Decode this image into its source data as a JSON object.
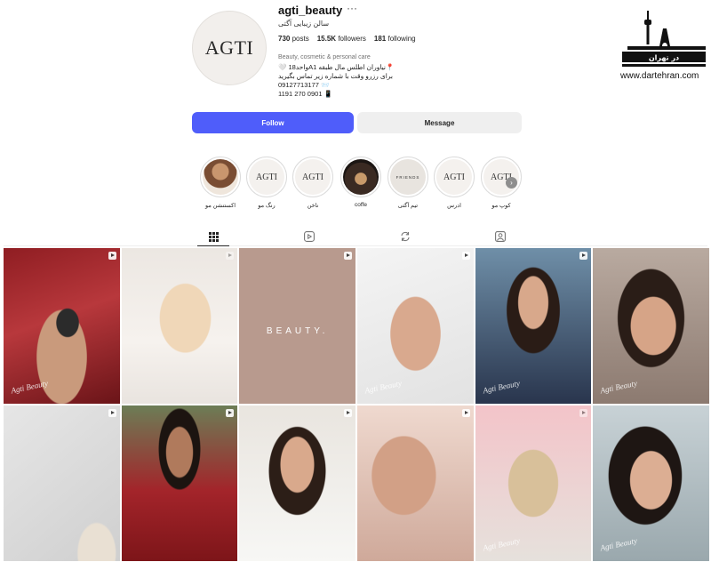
{
  "profile": {
    "avatar_text": "AGTI",
    "username": "agti_beauty",
    "more": "···",
    "subname": "سالن زیبایی آگتی",
    "stats": {
      "posts": "730",
      "posts_label": "posts",
      "followers": "15.5K",
      "followers_label": "followers",
      "following": "181",
      "following_label": "following"
    },
    "category": "Beauty, cosmetic & personal care",
    "bio": [
      "📍نیاوران اطلس مال طبقه A1واحد18 🤍",
      "برای رزرو وقت با شماره زیر تماس بگیرید",
      "09127713177 📨",
      "1191 270 0901 📱"
    ],
    "follow_label": "Follow",
    "message_label": "Message"
  },
  "highlights": [
    {
      "label": "اکستنشن مو",
      "inner": "",
      "style": "photo-hair"
    },
    {
      "label": "رنگ مو",
      "inner": "AGTI",
      "style": "logo"
    },
    {
      "label": "ناخن",
      "inner": "AGTI",
      "style": "logo"
    },
    {
      "label": "coffe",
      "inner": "",
      "style": "photo-coffee"
    },
    {
      "label": "تیم آگتی",
      "inner": "FRIENDS",
      "style": "friends"
    },
    {
      "label": "ادرس",
      "inner": "AGTI",
      "style": "logo"
    },
    {
      "label": "کوپ مو",
      "inner": "AGTI",
      "style": "logo"
    }
  ],
  "tabs": [
    "posts-grid",
    "reels",
    "tagged-reposts",
    "tagged"
  ],
  "posts": [
    {
      "kind": "reel",
      "watermark": "Agti Beauty"
    },
    {
      "kind": "photo",
      "watermark": ""
    },
    {
      "kind": "reel",
      "watermark": "",
      "text": "BEAUTY."
    },
    {
      "kind": "reel",
      "watermark": "Agti Beauty"
    },
    {
      "kind": "reel",
      "watermark": "Agti Beauty"
    },
    {
      "kind": "photo",
      "watermark": "Agti Beauty"
    },
    {
      "kind": "reel",
      "watermark": ""
    },
    {
      "kind": "reel",
      "watermark": ""
    },
    {
      "kind": "reel",
      "watermark": ""
    },
    {
      "kind": "reel",
      "watermark": ""
    },
    {
      "kind": "reel",
      "watermark": "Agti Beauty"
    },
    {
      "kind": "reel",
      "watermark": "Agti Beauty"
    }
  ],
  "branding": {
    "logo_text": "در تهران",
    "url": "www.dartehran.com"
  },
  "colors": {
    "accent": "#4f5dfa",
    "button_grey": "#efefef"
  }
}
